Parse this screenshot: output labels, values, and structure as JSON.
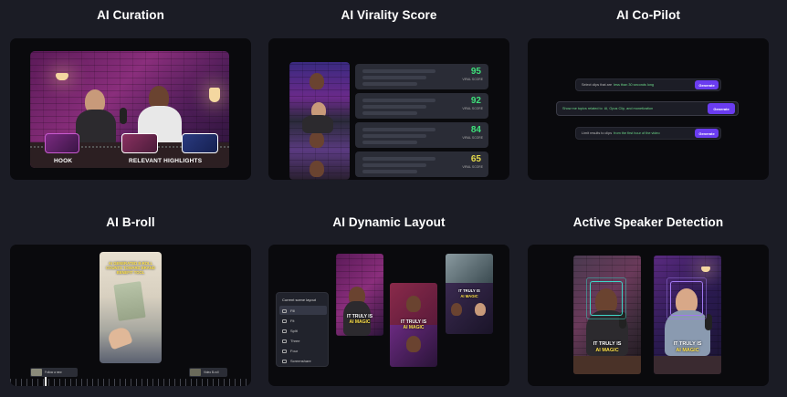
{
  "features": [
    {
      "title": "AI Curation"
    },
    {
      "title": "AI Virality Score"
    },
    {
      "title": "AI Co-Pilot"
    },
    {
      "title": "AI B-roll"
    },
    {
      "title": "AI Dynamic Layout"
    },
    {
      "title": "Active Speaker Detection"
    }
  ],
  "curation": {
    "hook_label": "HOOK",
    "highlights_label": "RELEVANT HIGHLIGHTS"
  },
  "virality": {
    "scores": [
      {
        "value": "95",
        "label": "VIRAL SCORE",
        "color": "#3ee07a"
      },
      {
        "value": "92",
        "label": "VIRAL SCORE",
        "color": "#3ee07a"
      },
      {
        "value": "84",
        "label": "VIRAL SCORE",
        "color": "#3ee07a"
      },
      {
        "value": "65",
        "label": "VIRAL SCORE",
        "color": "#e5d94a"
      }
    ]
  },
  "copilot": {
    "prompts": [
      {
        "pre": "Select clips that are",
        "hl": "less than 30 seconds long",
        "button": "Generate"
      },
      {
        "pre": "Show me topics related to",
        "hl": "AI, Opus Clip, and monetization",
        "button": "Generate"
      },
      {
        "pre": "Limit results to clips",
        "hl": "from the first hour of the video",
        "button": "Generate"
      }
    ]
  },
  "broll": {
    "caption": "AI GENERATED B-ROLL COUNTS TOWARD BRAND BENEFIT TOOL",
    "clip_left": "Follow a new",
    "clip_right": "Video B-roll"
  },
  "layout": {
    "menu_title": "Current scene layout",
    "options": [
      "Fill",
      "Fit",
      "Split",
      "Three",
      "Four",
      "Screenshare"
    ],
    "caption_a": "IT TRULY IS",
    "caption_b": "AI MAGIC"
  },
  "speaker": {
    "caption_a": "IT TRULY IS",
    "caption_b": "AI MAGIC"
  }
}
